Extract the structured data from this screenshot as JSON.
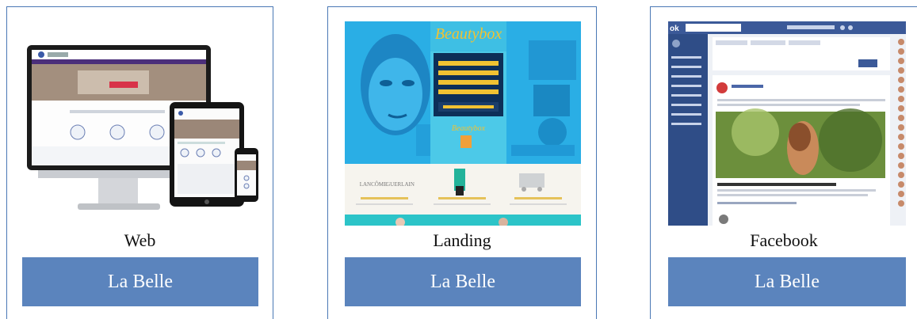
{
  "cards": [
    {
      "caption": "Web",
      "button_label": "La Belle"
    },
    {
      "caption": "Landing",
      "button_label": "La Belle"
    },
    {
      "caption": "Facebook",
      "button_label": "La Belle"
    }
  ],
  "colors": {
    "card_border": "#4a78b5",
    "button_bg": "#5b84bd",
    "button_text": "#ffffff"
  }
}
